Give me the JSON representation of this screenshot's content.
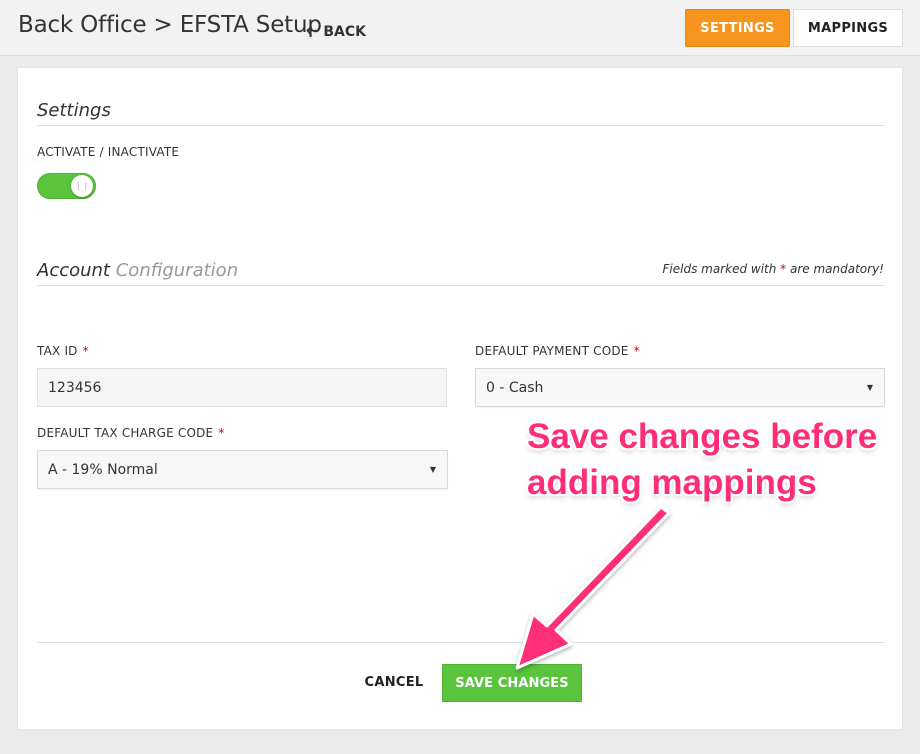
{
  "header": {
    "title": "Back Office > EFSTA Setup",
    "back_label": "BACK",
    "tabs": [
      {
        "label": "SETTINGS",
        "active": true
      },
      {
        "label": "MAPPINGS",
        "active": false
      }
    ]
  },
  "settings": {
    "heading": "Settings",
    "activate_label": "ACTIVATE / INACTIVATE",
    "activated": true
  },
  "account": {
    "heading_main": "Account",
    "heading_sub": "Configuration",
    "mandatory_prefix": "Fields marked with",
    "mandatory_star": "*",
    "mandatory_suffix": "are mandatory!"
  },
  "fields": {
    "tax_id": {
      "label": "TAX ID",
      "required_mark": "*",
      "value": "123456"
    },
    "default_payment_code": {
      "label": "DEFAULT PAYMENT CODE",
      "required_mark": "*",
      "value": "0 - Cash"
    },
    "default_tax_charge_code": {
      "label": "DEFAULT TAX CHARGE CODE",
      "required_mark": "*",
      "value": "A - 19% Normal"
    }
  },
  "actions": {
    "cancel_label": "CANCEL",
    "save_label": "SAVE CHANGES"
  },
  "annotation": {
    "line1": "Save changes before",
    "line2": "adding mappings"
  },
  "colors": {
    "accent_orange": "#f7941d",
    "toggle_green": "#5ac43c",
    "save_green": "#5ac43c",
    "required_red": "#d0021b",
    "annotation_pink": "#ff2d78"
  },
  "icons": {
    "back": "left-arrow-icon",
    "select_caret": "caret-down-icon"
  }
}
